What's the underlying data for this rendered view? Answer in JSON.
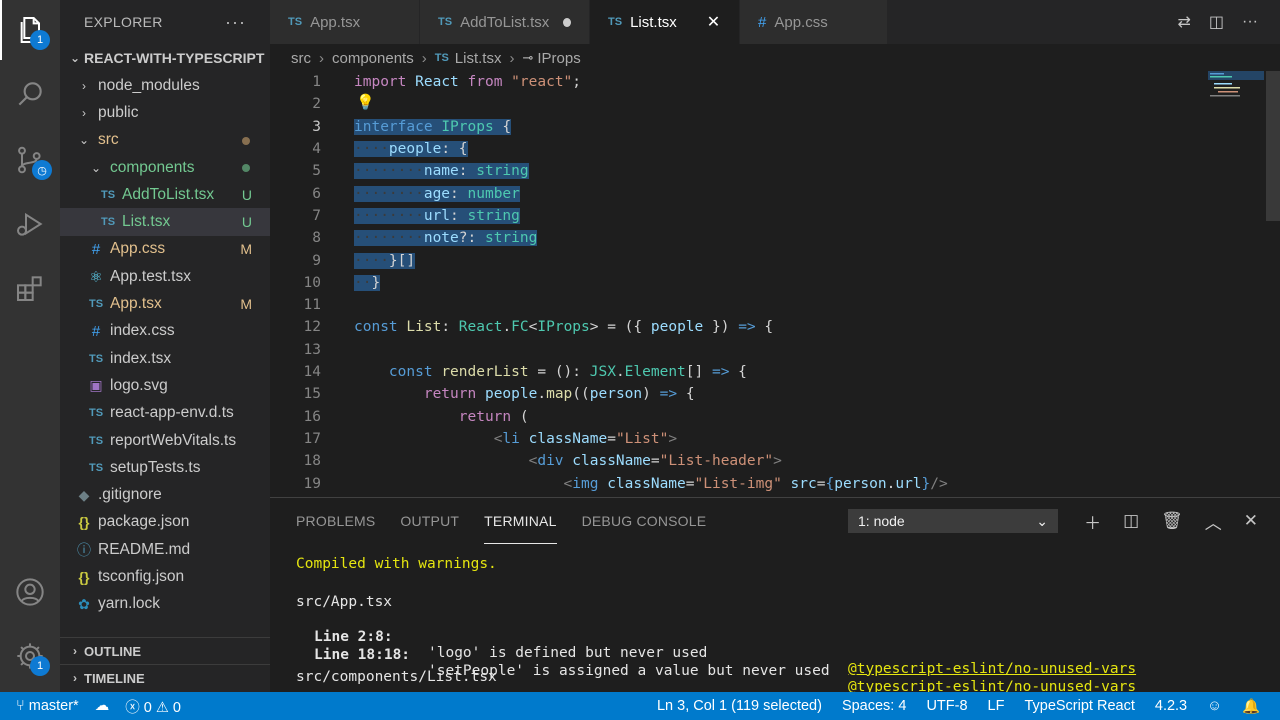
{
  "activity": {
    "explorer_badge": "1",
    "settings_badge": "1"
  },
  "sidebar": {
    "title": "EXPLORER",
    "more": "···",
    "project": "REACT-WITH-TYPESCRIPT",
    "items": [
      {
        "label": "node_modules",
        "indent": 1,
        "type": "folder-closed"
      },
      {
        "label": "public",
        "indent": 1,
        "type": "folder-closed"
      },
      {
        "label": "src",
        "indent": 1,
        "type": "folder-open",
        "color": "orange",
        "dot": "orange"
      },
      {
        "label": "components",
        "indent": 2,
        "type": "folder-open",
        "color": "green",
        "dot": "green"
      },
      {
        "label": "AddToList.tsx",
        "indent": 3,
        "type": "ts",
        "color": "green",
        "status": "U"
      },
      {
        "label": "List.tsx",
        "indent": 3,
        "type": "ts",
        "color": "green",
        "status": "U",
        "selected": true
      },
      {
        "label": "App.css",
        "indent": 2,
        "type": "css",
        "color": "orange",
        "status": "M"
      },
      {
        "label": "App.test.tsx",
        "indent": 2,
        "type": "react"
      },
      {
        "label": "App.tsx",
        "indent": 2,
        "type": "ts",
        "color": "orange",
        "status": "M"
      },
      {
        "label": "index.css",
        "indent": 2,
        "type": "css"
      },
      {
        "label": "index.tsx",
        "indent": 2,
        "type": "ts"
      },
      {
        "label": "logo.svg",
        "indent": 2,
        "type": "svg"
      },
      {
        "label": "react-app-env.d.ts",
        "indent": 2,
        "type": "ts"
      },
      {
        "label": "reportWebVitals.ts",
        "indent": 2,
        "type": "ts"
      },
      {
        "label": "setupTests.ts",
        "indent": 2,
        "type": "ts"
      },
      {
        "label": ".gitignore",
        "indent": 1,
        "type": "git"
      },
      {
        "label": "package.json",
        "indent": 1,
        "type": "json"
      },
      {
        "label": "README.md",
        "indent": 1,
        "type": "info"
      },
      {
        "label": "tsconfig.json",
        "indent": 1,
        "type": "json"
      },
      {
        "label": "yarn.lock",
        "indent": 1,
        "type": "yarn"
      }
    ],
    "outline": "OUTLINE",
    "timeline": "TIMELINE"
  },
  "tabs": [
    {
      "label": "App.tsx",
      "icon": "TS",
      "active": false
    },
    {
      "label": "AddToList.tsx",
      "icon": "TS",
      "active": false,
      "dirty": true
    },
    {
      "label": "List.tsx",
      "icon": "TS",
      "active": true
    },
    {
      "label": "App.css",
      "icon": "#",
      "active": false
    }
  ],
  "breadcrumb": {
    "parts": [
      "src",
      "components"
    ],
    "file": "List.tsx",
    "symbol": "IProps"
  },
  "editor": {
    "current_line": 3,
    "line_numbers": [
      "1",
      "2",
      "3",
      "4",
      "5",
      "6",
      "7",
      "8",
      "9",
      "10",
      "11",
      "12",
      "13",
      "14",
      "15",
      "16",
      "17",
      "18",
      "19"
    ]
  },
  "panel": {
    "tabs": [
      "PROBLEMS",
      "OUTPUT",
      "TERMINAL",
      "DEBUG CONSOLE"
    ],
    "active_tab": "TERMINAL",
    "terminal_select": "1: node",
    "lines": {
      "compiled": "Compiled with warnings.",
      "file1": "src/App.tsx",
      "w1_loc": "Line 2:8:",
      "w1_msg": "'logo' is defined but never used",
      "w1_rule": "@typescript-eslint/no-unused-vars",
      "w2_loc": "Line 18:18:",
      "w2_msg": "'setPeople' is assigned a value but never used",
      "w2_rule": "@typescript-eslint/no-unused-vars",
      "file2": "src/components/List.tsx"
    }
  },
  "statusbar": {
    "branch": "master*",
    "errors": "0",
    "warnings": "0",
    "cursor": "Ln 3, Col 1 (119 selected)",
    "spaces": "Spaces: 4",
    "encoding": "UTF-8",
    "eol": "LF",
    "language": "TypeScript React",
    "version": "4.2.3"
  },
  "colors": {
    "accent": "#007acc",
    "selection": "#264f78",
    "git_untracked": "#73c991",
    "git_modified": "#e2c08d"
  }
}
